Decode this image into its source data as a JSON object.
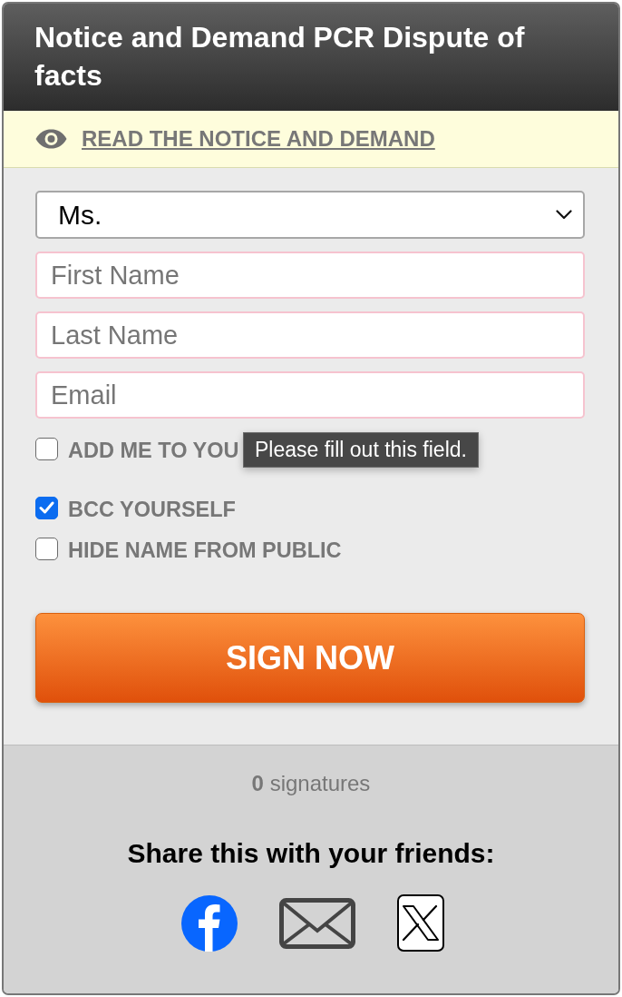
{
  "header": {
    "title": "Notice and Demand PCR Dispute of facts"
  },
  "notice": {
    "link": "READ THE NOTICE AND DEMAND"
  },
  "form": {
    "salutation": {
      "value": "Ms."
    },
    "fields": [
      {
        "placeholder": "First Name"
      },
      {
        "placeholder": "Last Name"
      },
      {
        "placeholder": "Email",
        "tooltip": "Please fill out this field."
      }
    ],
    "options": [
      {
        "label": "ADD ME TO YOU",
        "checked": false
      },
      {
        "label": "BCC YOURSELF",
        "checked": true
      },
      {
        "label": "HIDE NAME FROM PUBLIC",
        "checked": false
      }
    ],
    "submit": "SIGN NOW"
  },
  "footer": {
    "count": "**0** signatures",
    "share_heading": "Share this with your friends:",
    "share_buttons": [
      {
        "kind": "facebook"
      },
      {
        "kind": "email"
      },
      {
        "kind": "x"
      }
    ]
  }
}
